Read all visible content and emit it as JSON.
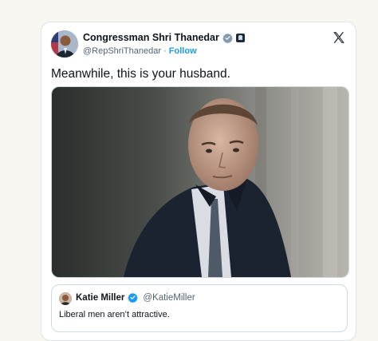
{
  "tweet": {
    "author_name": "Congressman Shri Thanedar",
    "author_handle": "@RepShriThanedar",
    "separator": "·",
    "follow_label": "Follow",
    "text": "Meanwhile, this is your husband."
  },
  "quoted_tweet": {
    "author_name": "Katie Miller",
    "author_handle": "@KatieMiller",
    "text": "Liberal men aren’t attractive."
  },
  "colors": {
    "accent": "#1d9bf0",
    "text": "#0f1419",
    "muted": "#536471",
    "page_background": "#f7f6f0"
  },
  "icons": {
    "verified": "verified-badge-icon",
    "government": "government-badge-icon",
    "platform": "x-logo-icon"
  }
}
